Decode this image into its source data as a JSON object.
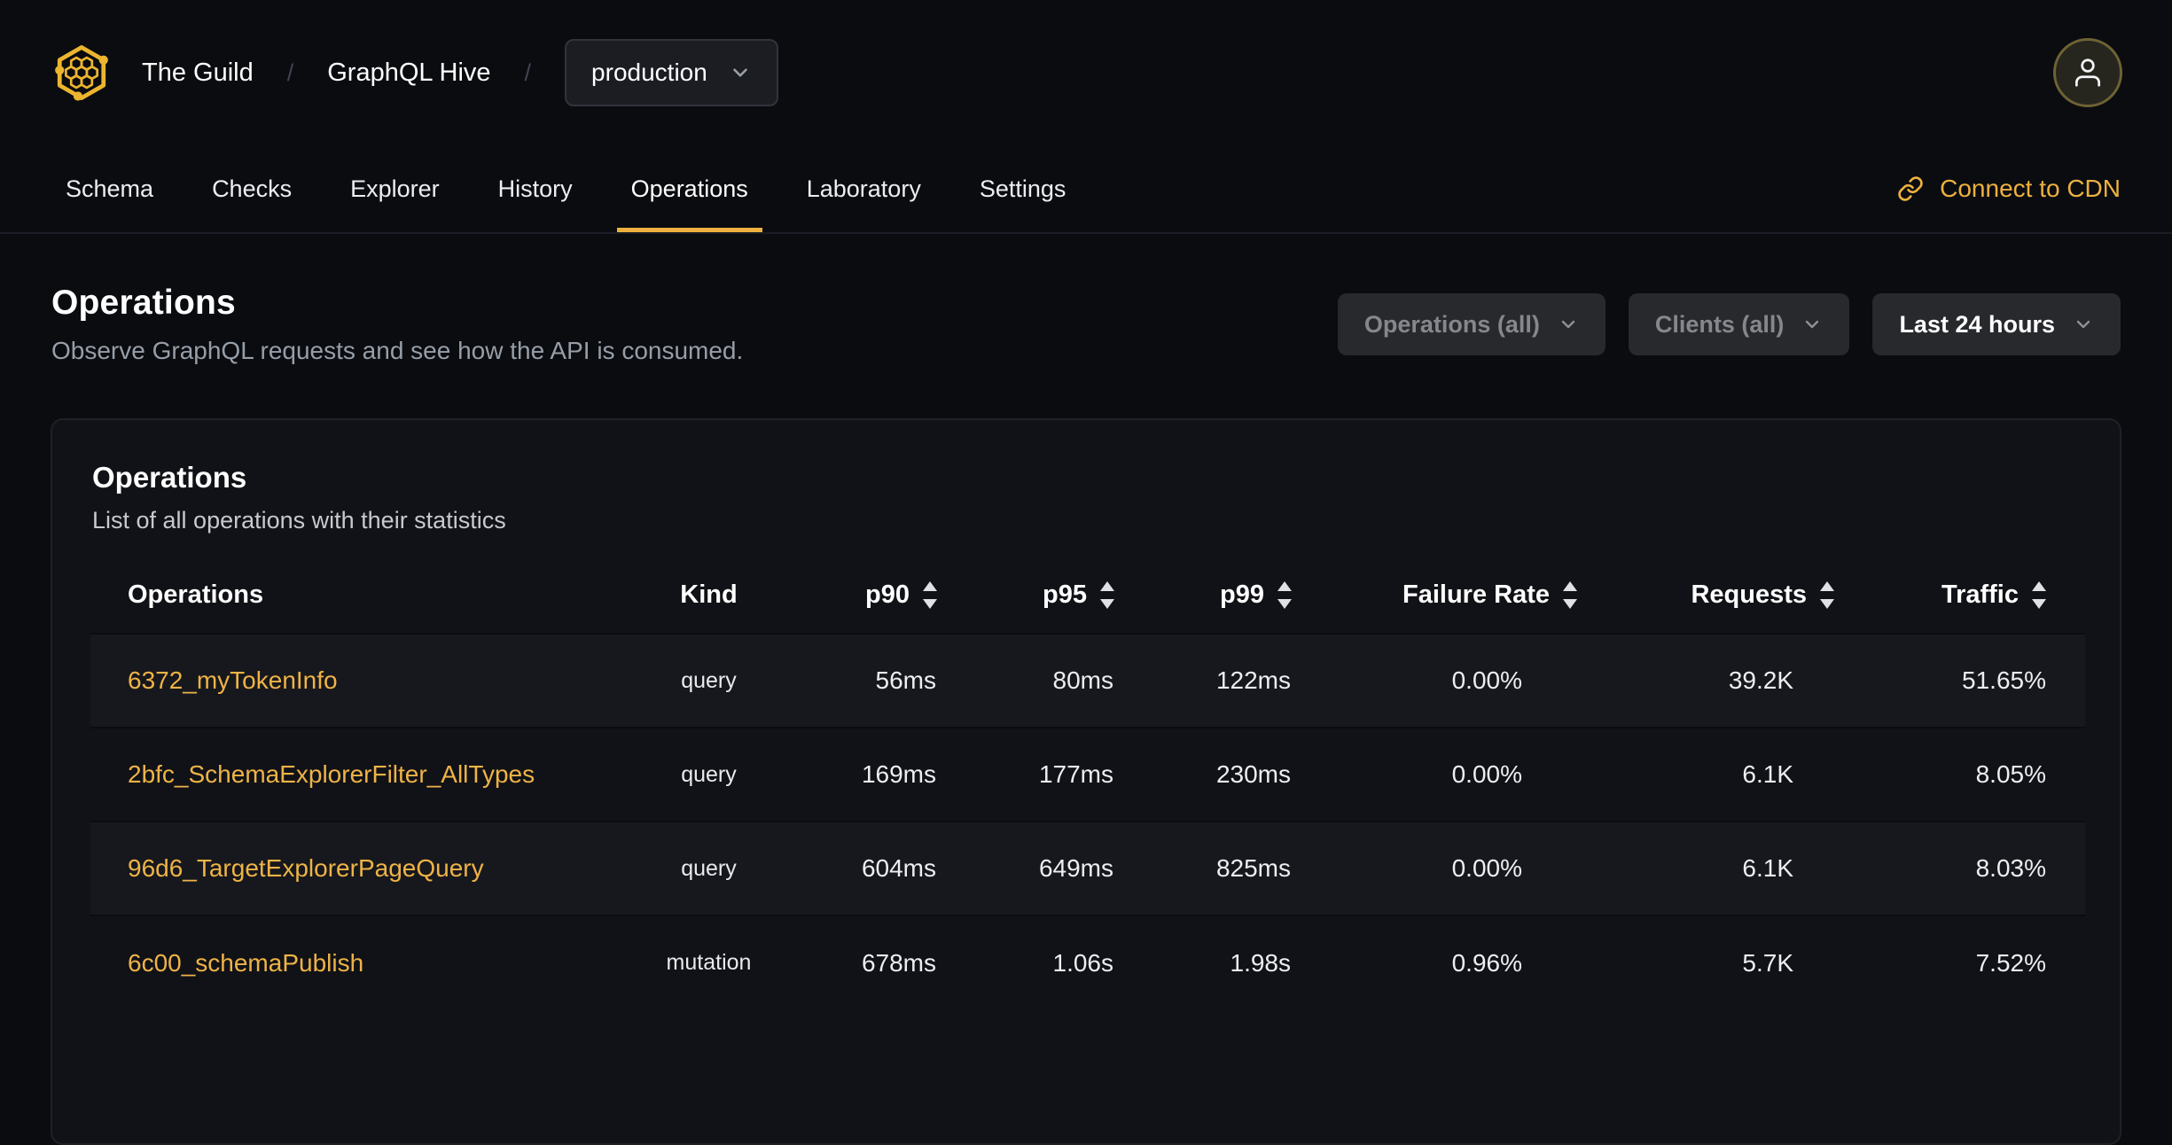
{
  "header": {
    "breadcrumb": [
      {
        "label": "The Guild"
      },
      {
        "label": "GraphQL Hive"
      }
    ],
    "separator": "/",
    "target_selector": {
      "value": "production"
    }
  },
  "nav": {
    "tabs": [
      {
        "label": "Schema",
        "active": false
      },
      {
        "label": "Checks",
        "active": false
      },
      {
        "label": "Explorer",
        "active": false
      },
      {
        "label": "History",
        "active": false
      },
      {
        "label": "Operations",
        "active": true
      },
      {
        "label": "Laboratory",
        "active": false
      },
      {
        "label": "Settings",
        "active": false
      }
    ],
    "cdn_link_label": "Connect to CDN"
  },
  "page": {
    "title": "Operations",
    "subtitle": "Observe GraphQL requests and see how the API is consumed.",
    "filters": [
      {
        "label": "Operations (all)",
        "disabled": true
      },
      {
        "label": "Clients (all)",
        "disabled": true
      },
      {
        "label": "Last 24 hours",
        "disabled": false
      }
    ]
  },
  "card": {
    "title": "Operations",
    "subtitle": "List of all operations with their statistics",
    "table": {
      "columns": [
        {
          "label": "Operations",
          "sortable": false,
          "align": "left"
        },
        {
          "label": "Kind",
          "sortable": false,
          "align": "center"
        },
        {
          "label": "p90",
          "sortable": true,
          "align": "right"
        },
        {
          "label": "p95",
          "sortable": true,
          "align": "right"
        },
        {
          "label": "p99",
          "sortable": true,
          "align": "right"
        },
        {
          "label": "Failure Rate",
          "sortable": true,
          "align": "right"
        },
        {
          "label": "Requests",
          "sortable": true,
          "align": "right"
        },
        {
          "label": "Traffic",
          "sortable": true,
          "align": "right"
        }
      ],
      "rows": [
        {
          "operation": "6372_myTokenInfo",
          "kind": "query",
          "p90": "56ms",
          "p95": "80ms",
          "p99": "122ms",
          "failure_rate": "0.00%",
          "requests": "39.2K",
          "traffic": "51.65%"
        },
        {
          "operation": "2bfc_SchemaExplorerFilter_AllTypes",
          "kind": "query",
          "p90": "169ms",
          "p95": "177ms",
          "p99": "230ms",
          "failure_rate": "0.00%",
          "requests": "6.1K",
          "traffic": "8.05%"
        },
        {
          "operation": "96d6_TargetExplorerPageQuery",
          "kind": "query",
          "p90": "604ms",
          "p95": "649ms",
          "p99": "825ms",
          "failure_rate": "0.00%",
          "requests": "6.1K",
          "traffic": "8.03%"
        },
        {
          "operation": "6c00_schemaPublish",
          "kind": "mutation",
          "p90": "678ms",
          "p95": "1.06s",
          "p99": "1.98s",
          "failure_rate": "0.96%",
          "requests": "5.7K",
          "traffic": "7.52%"
        }
      ]
    }
  },
  "icons": {
    "logo": "hive-hexagon-logo",
    "avatar": "user-icon",
    "dropdown": "chevron-down-icon",
    "cdn": "link-icon",
    "sort": "sort-arrows-icon"
  },
  "colors": {
    "accent": "#eeb13f",
    "link": "#eeb347",
    "page_bg": "#0a0c10",
    "card_bg": "#111217",
    "row_alt": "#17181d",
    "btn_bg": "#28292d",
    "select_bg": "#1b1d23"
  }
}
